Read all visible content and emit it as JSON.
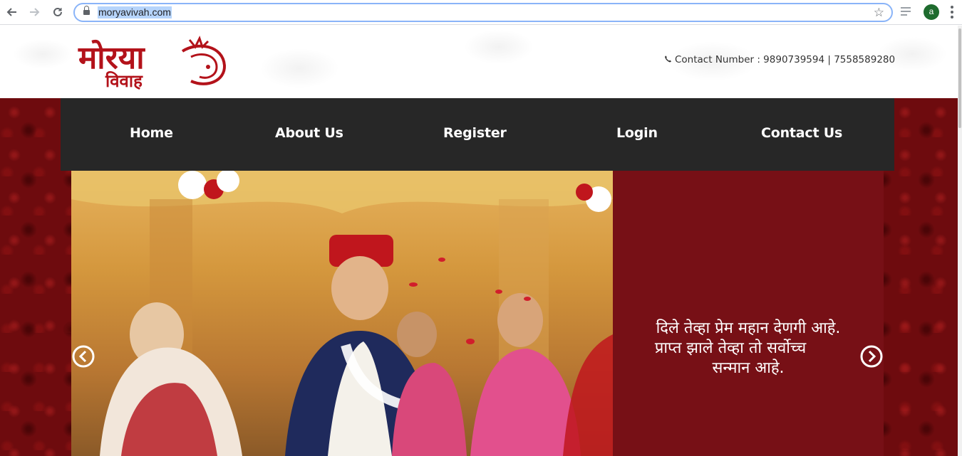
{
  "browser": {
    "url": "moryavivah.com",
    "profile_initial": "a"
  },
  "header": {
    "logo_text_primary": "मोरया",
    "logo_text_secondary": "विवाह",
    "contact_label": "Contact Number : 9890739594 | 7558589280"
  },
  "nav": {
    "items": [
      {
        "label": "Home"
      },
      {
        "label": "About Us"
      },
      {
        "label": "Register"
      },
      {
        "label": "Login"
      },
      {
        "label": "Contact Us"
      }
    ]
  },
  "slider": {
    "quote_lines": [
      "दिले तेव्हा प्रेम महान देणगी आहे.",
      "प्राप्त झाले तेव्हा तो सर्वोच्च",
      "सन्मान आहे."
    ]
  },
  "colors": {
    "navbar": "#272727",
    "caption_panel": "#771016",
    "brand_red": "#b3121a",
    "band": "#6e0b0e"
  }
}
